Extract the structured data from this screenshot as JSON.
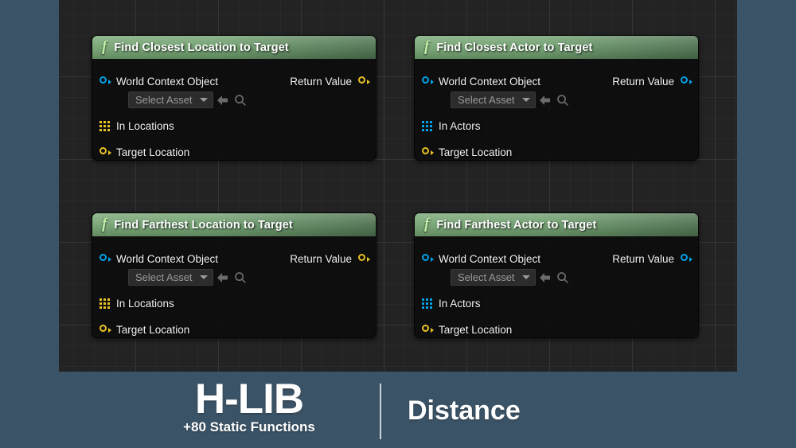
{
  "canvas": {
    "background_color": "#232323",
    "grid": true
  },
  "page": {
    "outer_background_color": "#3b5366"
  },
  "nodes": [
    {
      "id": "find-closest-location-to-target",
      "title": "Find Closest Location to Target",
      "function_icon": "f",
      "header_color": "#6e9e6d",
      "inputs": [
        {
          "label": "World Context Object",
          "pin_type": "object",
          "pin_color": "#00a2e8",
          "widget": {
            "type": "asset-dropdown",
            "value": "Select Asset",
            "caret_icon": "chevron-down-icon",
            "use_selected_icon": "back-arrow-icon",
            "browse_icon": "magnifier-icon"
          }
        },
        {
          "label": "In Locations",
          "pin_type": "array",
          "pin_color": "#e8c224"
        },
        {
          "label": "Target Location",
          "pin_type": "vector",
          "pin_color": "#e8c224"
        }
      ],
      "outputs": [
        {
          "label": "Return Value",
          "pin_type": "vector",
          "pin_color": "#e8c224"
        }
      ]
    },
    {
      "id": "find-closest-actor-to-target",
      "title": "Find Closest Actor to Target",
      "function_icon": "f",
      "header_color": "#6e9e6d",
      "inputs": [
        {
          "label": "World Context Object",
          "pin_type": "object",
          "pin_color": "#00a2e8",
          "widget": {
            "type": "asset-dropdown",
            "value": "Select Asset",
            "caret_icon": "chevron-down-icon",
            "use_selected_icon": "back-arrow-icon",
            "browse_icon": "magnifier-icon"
          }
        },
        {
          "label": "In Actors",
          "pin_type": "array",
          "pin_color": "#00a2e8"
        },
        {
          "label": "Target Location",
          "pin_type": "vector",
          "pin_color": "#e8c224"
        }
      ],
      "outputs": [
        {
          "label": "Return Value",
          "pin_type": "object",
          "pin_color": "#00a2e8"
        }
      ]
    },
    {
      "id": "find-farthest-location-to-target",
      "title": "Find Farthest Location to Target",
      "function_icon": "f",
      "header_color": "#6e9e6d",
      "inputs": [
        {
          "label": "World Context Object",
          "pin_type": "object",
          "pin_color": "#00a2e8",
          "widget": {
            "type": "asset-dropdown",
            "value": "Select Asset",
            "caret_icon": "chevron-down-icon",
            "use_selected_icon": "back-arrow-icon",
            "browse_icon": "magnifier-icon"
          }
        },
        {
          "label": "In Locations",
          "pin_type": "array",
          "pin_color": "#e8c224"
        },
        {
          "label": "Target Location",
          "pin_type": "vector",
          "pin_color": "#e8c224"
        }
      ],
      "outputs": [
        {
          "label": "Return Value",
          "pin_type": "vector",
          "pin_color": "#e8c224"
        }
      ]
    },
    {
      "id": "find-farthest-actor-to-target",
      "title": "Find Farthest Actor to Target",
      "function_icon": "f",
      "header_color": "#6e9e6d",
      "inputs": [
        {
          "label": "World Context Object",
          "pin_type": "object",
          "pin_color": "#00a2e8",
          "widget": {
            "type": "asset-dropdown",
            "value": "Select Asset",
            "caret_icon": "chevron-down-icon",
            "use_selected_icon": "back-arrow-icon",
            "browse_icon": "magnifier-icon"
          }
        },
        {
          "label": "In Actors",
          "pin_type": "array",
          "pin_color": "#00a2e8"
        },
        {
          "label": "Target Location",
          "pin_type": "vector",
          "pin_color": "#e8c224"
        }
      ],
      "outputs": [
        {
          "label": "Return Value",
          "pin_type": "object",
          "pin_color": "#00a2e8"
        }
      ]
    }
  ],
  "banner": {
    "brand_title": "H-LIB",
    "brand_subtitle": "+80 Static Functions",
    "category": "Distance",
    "divider_color": "#c9d3da",
    "background_color": "#3b5366"
  }
}
